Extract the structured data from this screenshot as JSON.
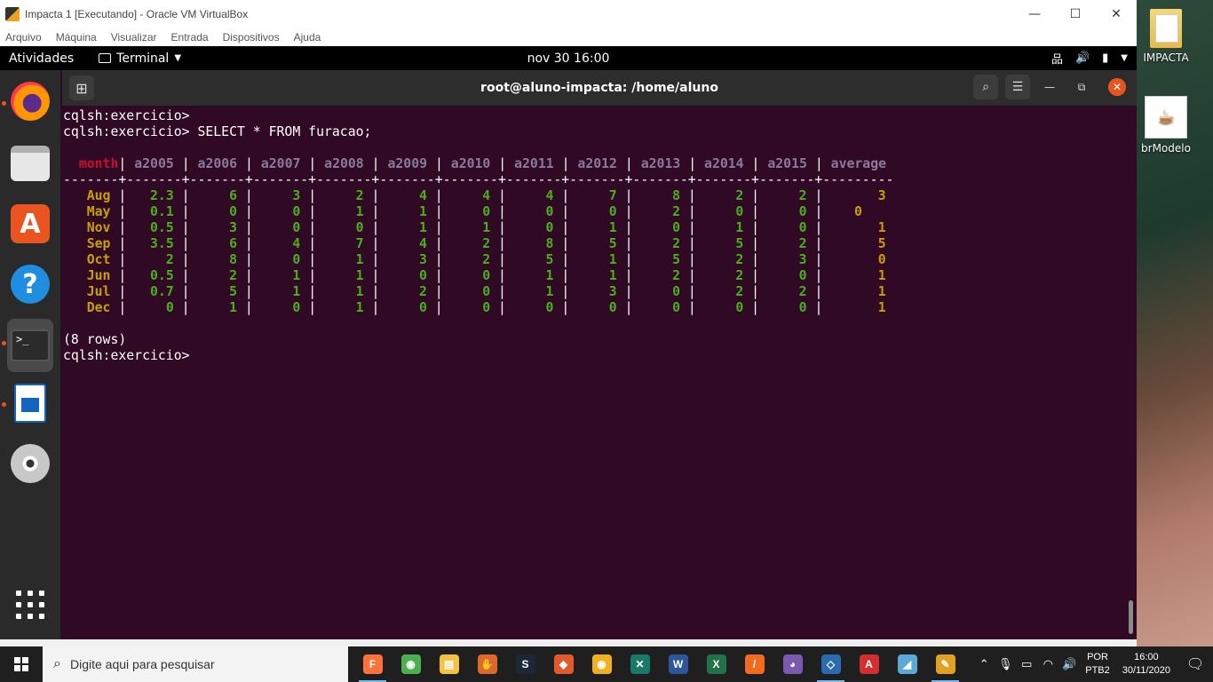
{
  "vbox": {
    "title": "Impacta 1 [Executando] - Oracle VM VirtualBox",
    "menus": [
      "Arquivo",
      "Máquina",
      "Visualizar",
      "Entrada",
      "Dispositivos",
      "Ajuda"
    ]
  },
  "topbar": {
    "activities": "Atividades",
    "app_menu": "Terminal",
    "clock": "nov 30  16:00"
  },
  "terminal": {
    "title": "root@aluno-impacta: /home/aluno",
    "prompt_lines": [
      "cqlsh:exercicio>",
      "cqlsh:exercicio> SELECT * FROM furacao;"
    ],
    "columns": [
      "month",
      "a2005",
      "a2006",
      "a2007",
      "a2008",
      "a2009",
      "a2010",
      "a2011",
      "a2012",
      "a2013",
      "a2014",
      "a2015",
      "average"
    ],
    "rows": [
      [
        "Aug",
        "2.3",
        "6",
        "3",
        "2",
        "4",
        "4",
        "4",
        "7",
        "8",
        "2",
        "2",
        "3"
      ],
      [
        "May",
        "0.1",
        "0",
        "0",
        "1",
        "1",
        "0",
        "0",
        "0",
        "2",
        "0",
        "0",
        "0"
      ],
      [
        "Nov",
        "0.5",
        "3",
        "0",
        "0",
        "1",
        "1",
        "0",
        "1",
        "0",
        "1",
        "0",
        "1"
      ],
      [
        "Sep",
        "3.5",
        "6",
        "4",
        "7",
        "4",
        "2",
        "8",
        "5",
        "2",
        "5",
        "2",
        "5"
      ],
      [
        "Oct",
        "2",
        "8",
        "0",
        "1",
        "3",
        "2",
        "5",
        "1",
        "5",
        "2",
        "3",
        "0"
      ],
      [
        "Jun",
        "0.5",
        "2",
        "1",
        "1",
        "0",
        "0",
        "1",
        "1",
        "2",
        "2",
        "0",
        "1"
      ],
      [
        "Jul",
        "0.7",
        "5",
        "1",
        "1",
        "2",
        "0",
        "1",
        "3",
        "0",
        "2",
        "2",
        "1"
      ],
      [
        "Dec",
        "0",
        "1",
        "0",
        "1",
        "0",
        "0",
        "0",
        "0",
        "0",
        "0",
        "0",
        "1"
      ]
    ],
    "row_count": "(8 rows)",
    "final_prompt": "cqlsh:exercicio>"
  },
  "desktop": {
    "icons": [
      {
        "label": "IMPACTA",
        "icon": "folder-icon"
      },
      {
        "label": "brModelo",
        "icon": "java-icon"
      }
    ]
  },
  "taskbar": {
    "search_placeholder": "Digite aqui para pesquisar",
    "apps": [
      "firefox-icon",
      "chrome-icon",
      "file-explorer-icon",
      "app-icon",
      "steam-icon",
      "app-icon-2",
      "chrome-canary-icon",
      "app-icon-3",
      "word-icon",
      "excel-icon",
      "app-icon-4",
      "app-icon-5",
      "virtualbox-icon",
      "acrobat-icon",
      "app-icon-6",
      "app-icon-7"
    ],
    "lang_top": "POR",
    "lang_bottom": "PTB2",
    "time": "16:00",
    "date": "30/11/2020"
  }
}
